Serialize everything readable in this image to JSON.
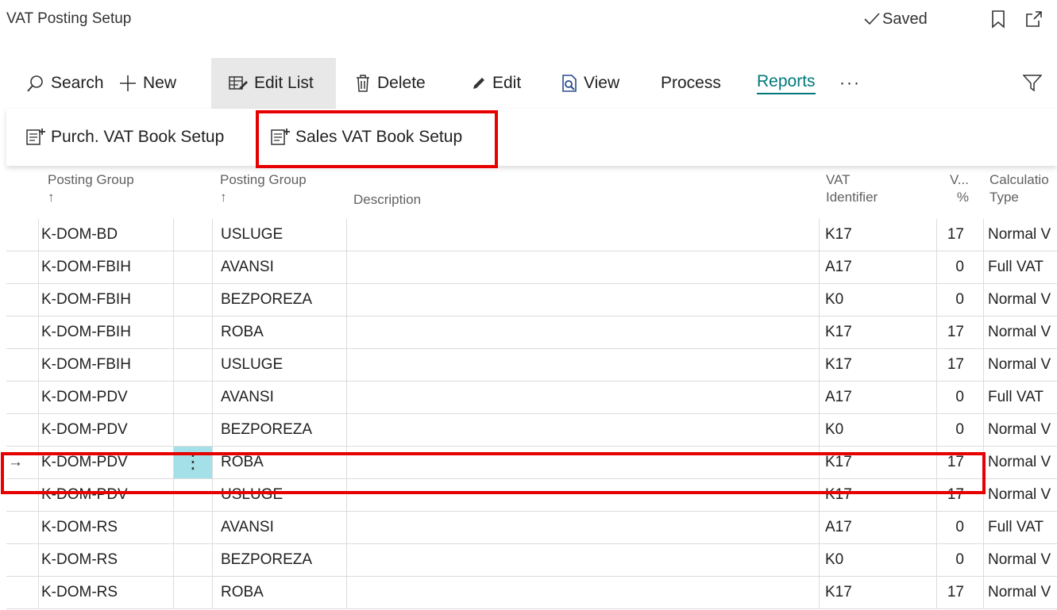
{
  "page": {
    "title": "VAT Posting Setup",
    "status": "Saved"
  },
  "toolbar": {
    "search": "Search",
    "new": "New",
    "edit_list": "Edit List",
    "delete": "Delete",
    "edit": "Edit",
    "view": "View",
    "process": "Process",
    "reports": "Reports",
    "more": "···"
  },
  "submenu": {
    "purch": "Purch. VAT Book Setup",
    "sales": "Sales VAT Book Setup"
  },
  "columns": {
    "bus_group": "Posting Group",
    "prod_group": "Posting Group",
    "sort_arrow": "↑",
    "description": "Description",
    "vat_identifier_1": "VAT",
    "vat_identifier_2": "Identifier",
    "vat_pct_1": "V...",
    "vat_pct_2": "%",
    "calc_type_1": "Calculatio",
    "calc_type_2": "Type"
  },
  "rows": [
    {
      "bus": "K-DOM-BD",
      "prod": "USLUGE",
      "desc": "",
      "vat_id": "K17",
      "pct": "17",
      "calc": "Normal V"
    },
    {
      "bus": "K-DOM-FBIH",
      "prod": "AVANSI",
      "desc": "",
      "vat_id": "A17",
      "pct": "0",
      "calc": "Full VAT"
    },
    {
      "bus": "K-DOM-FBIH",
      "prod": "BEZPOREZA",
      "desc": "",
      "vat_id": "K0",
      "pct": "0",
      "calc": "Normal V"
    },
    {
      "bus": "K-DOM-FBIH",
      "prod": "ROBA",
      "desc": "",
      "vat_id": "K17",
      "pct": "17",
      "calc": "Normal V"
    },
    {
      "bus": "K-DOM-FBIH",
      "prod": "USLUGE",
      "desc": "",
      "vat_id": "K17",
      "pct": "17",
      "calc": "Normal V"
    },
    {
      "bus": "K-DOM-PDV",
      "prod": "AVANSI",
      "desc": "",
      "vat_id": "A17",
      "pct": "0",
      "calc": "Full VAT"
    },
    {
      "bus": "K-DOM-PDV",
      "prod": "BEZPOREZA",
      "desc": "",
      "vat_id": "K0",
      "pct": "0",
      "calc": "Normal V"
    },
    {
      "bus": "K-DOM-PDV",
      "prod": "ROBA",
      "desc": "",
      "vat_id": "K17",
      "pct": "17",
      "calc": "Normal V"
    },
    {
      "bus": "K-DOM-PDV",
      "prod": "USLUGE",
      "desc": "",
      "vat_id": "K17",
      "pct": "17",
      "calc": "Normal V"
    },
    {
      "bus": "K-DOM-RS",
      "prod": "AVANSI",
      "desc": "",
      "vat_id": "A17",
      "pct": "0",
      "calc": "Full VAT"
    },
    {
      "bus": "K-DOM-RS",
      "prod": "BEZPOREZA",
      "desc": "",
      "vat_id": "K0",
      "pct": "0",
      "calc": "Normal V"
    },
    {
      "bus": "K-DOM-RS",
      "prod": "ROBA",
      "desc": "",
      "vat_id": "K17",
      "pct": "17",
      "calc": "Normal V"
    }
  ],
  "selected_row_index": 7,
  "selected_row_arrow": "→",
  "row_menu_glyph": "⋮",
  "accent_color": "#00787a",
  "highlight_color": "#e60000"
}
